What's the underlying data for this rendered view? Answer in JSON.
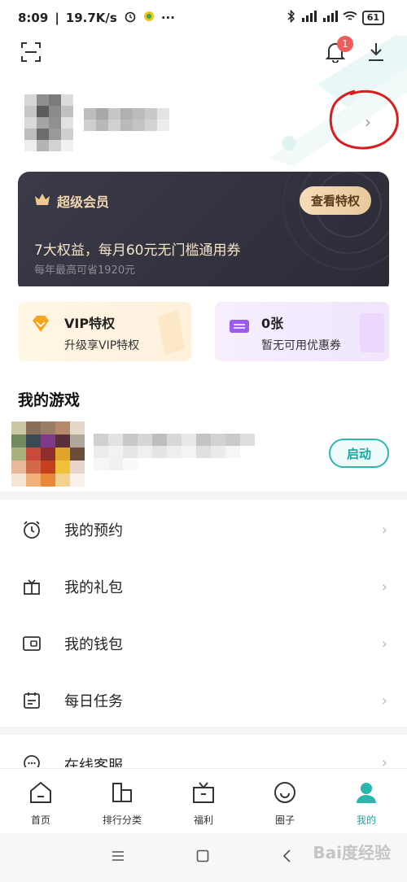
{
  "status_bar": {
    "time": "8:09",
    "speed": "19.7K/s",
    "battery": "61"
  },
  "header": {
    "notification_count": "1"
  },
  "vip_card": {
    "title": "超级会员",
    "cta": "查看特权",
    "line1": "7大权益，每月60元无门槛通用券",
    "line2": "每年最高可省1920元"
  },
  "tiles": {
    "vip": {
      "title": "VIP特权",
      "subtitle": "升级享VIP特权"
    },
    "coupon": {
      "title": "0张",
      "subtitle": "暂无可用优惠券"
    }
  },
  "my_games": {
    "title": "我的游戏",
    "launch_label": "启动"
  },
  "menu": [
    {
      "label": "我的预约",
      "icon": "alarm-clock-icon"
    },
    {
      "label": "我的礼包",
      "icon": "gift-icon"
    },
    {
      "label": "我的钱包",
      "icon": "wallet-icon"
    },
    {
      "label": "每日任务",
      "icon": "calendar-icon"
    },
    {
      "label": "在线客服",
      "icon": "chat-bubble-icon"
    }
  ],
  "tabs": [
    {
      "label": "首页",
      "icon": "home-icon"
    },
    {
      "label": "排行分类",
      "icon": "ranking-icon"
    },
    {
      "label": "福利",
      "icon": "gift-box-icon"
    },
    {
      "label": "圈子",
      "icon": "circle-icon"
    },
    {
      "label": "我的",
      "icon": "user-icon"
    }
  ],
  "watermark": "Bai度经验",
  "colors": {
    "accent": "#1aa79f",
    "vip_dark": "#2c2c38",
    "vip_gold": "#f2d7b0",
    "badge": "#f25b5b",
    "annotation_red": "#d81e1e"
  }
}
